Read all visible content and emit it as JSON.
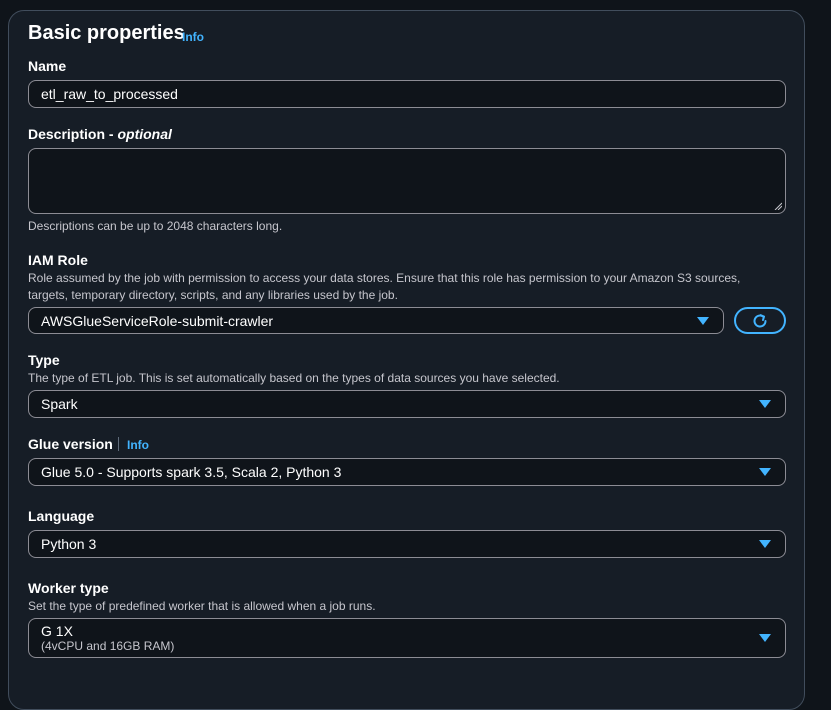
{
  "section": {
    "title": "Basic properties",
    "info_link": "Info"
  },
  "name": {
    "label": "Name",
    "value": "etl_raw_to_processed"
  },
  "description": {
    "label": "Description - ",
    "label_optional": "optional",
    "value": "",
    "hint": "Descriptions can be up to 2048 characters long."
  },
  "iam_role": {
    "label": "IAM Role",
    "desc_line1": "Role assumed by the job with permission to access your data stores. Ensure that this role has permission to your Amazon S3 sources,",
    "desc_line2": "targets, temporary directory, scripts, and any libraries used by the job.",
    "selected": "AWSGlueServiceRole-submit-crawler",
    "refresh_icon": "refresh-icon"
  },
  "type": {
    "label": "Type",
    "desc": "The type of ETL job. This is set automatically based on the types of data sources you have selected.",
    "selected": "Spark"
  },
  "glue_version": {
    "label": "Glue version",
    "info_link": "Info",
    "selected": "Glue 5.0 - Supports spark 3.5, Scala 2, Python 3"
  },
  "language": {
    "label": "Language",
    "selected": "Python 3"
  },
  "worker_type": {
    "label": "Worker type",
    "desc": "Set the type of predefined worker that is allowed when a job runs.",
    "selected": "G 1X",
    "selected_detail": "(4vCPU and 16GB RAM)"
  },
  "colors": {
    "accent": "#42b4ff",
    "panel_bg": "#161d26",
    "page_bg": "#0f141a",
    "border": "#8c8c94"
  }
}
